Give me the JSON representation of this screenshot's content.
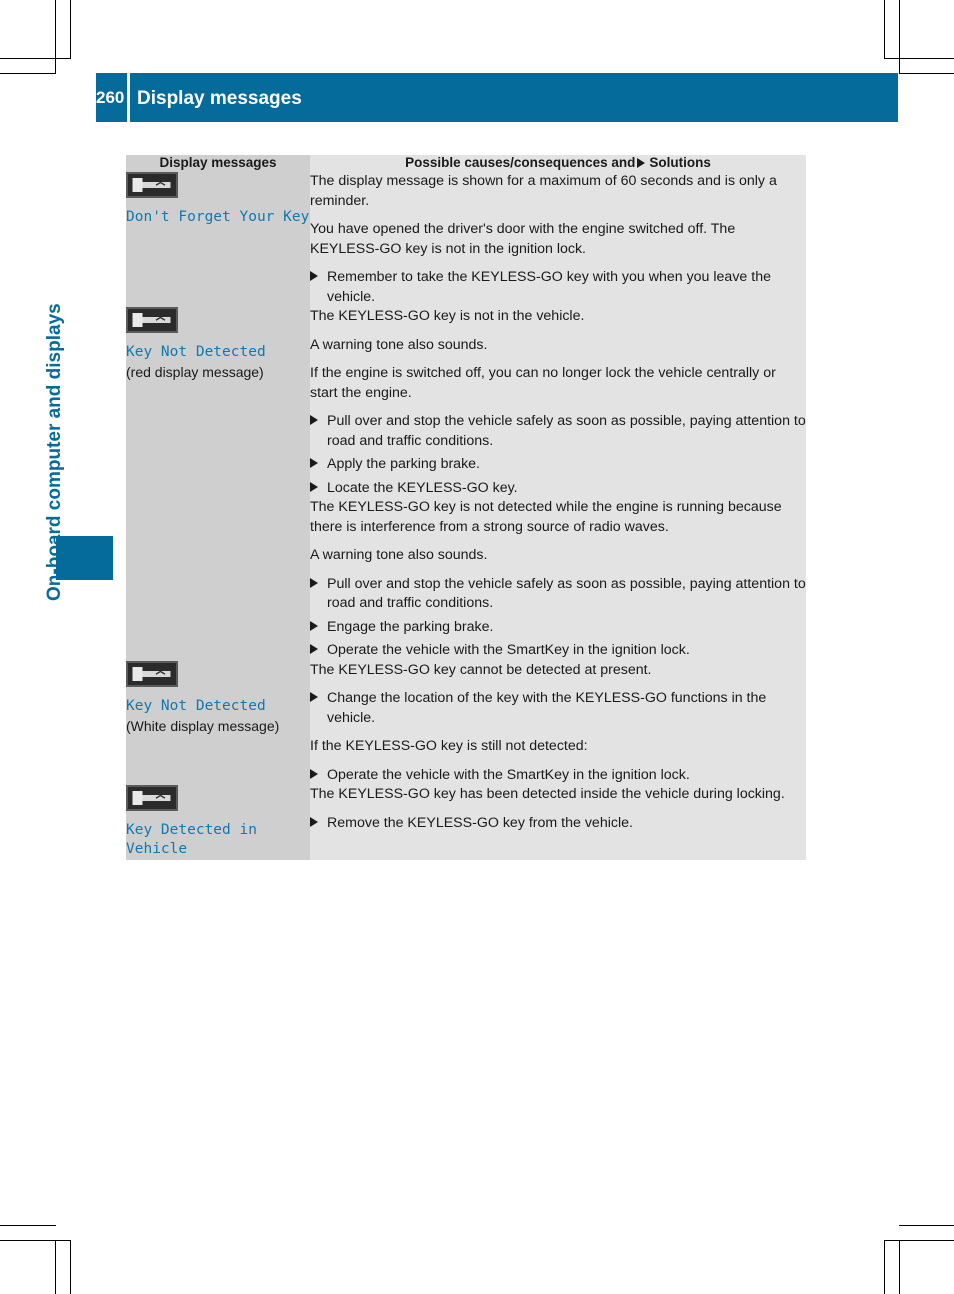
{
  "page": {
    "number": "260",
    "header_title": "Display messages",
    "chapter_label": "On-board computer and displays",
    "accent_color": "#046b9b",
    "message_text_color": "#1178b0"
  },
  "table": {
    "headers": {
      "col1": "Display messages",
      "col2_before_icon": "Possible causes/consequences and",
      "col2_after_icon": "Solutions",
      "solutions_arrow_icon": "solid-right-triangle-icon"
    },
    "rows": [
      {
        "icon": "keyless-go-key-icon",
        "message": "Don't Forget Your Key",
        "note": "",
        "blocks": [
          {
            "paragraphs": [
              "The display message is shown for a maximum of 60 seconds and is only a reminder.",
              "You have opened the driver's door with the engine switched off. The KEYLESS-GO key is not in the ignition lock."
            ],
            "steps": [
              "Remember to take the KEYLESS-GO key with you when you leave the vehicle."
            ]
          }
        ]
      },
      {
        "icon": "keyless-go-key-icon",
        "message": "Key Not Detected",
        "note": "(red display message)",
        "blocks": [
          {
            "paragraphs": [
              "The KEYLESS-GO key is not in the vehicle.",
              "A warning tone also sounds.",
              "If the engine is switched off, you can no longer lock the vehicle centrally or start the engine."
            ],
            "steps": [
              "Pull over and stop the vehicle safely as soon as possible, paying attention to road and traffic conditions.",
              "Apply the parking brake.",
              "Locate the KEYLESS-GO key."
            ]
          },
          {
            "paragraphs": [
              "The KEYLESS-GO key is not detected while the engine is running because there is interference from a strong source of radio waves.",
              "A warning tone also sounds."
            ],
            "steps": [
              "Pull over and stop the vehicle safely as soon as possible, paying attention to road and traffic conditions.",
              "Engage the parking brake.",
              "Operate the vehicle with the SmartKey in the ignition lock."
            ]
          }
        ]
      },
      {
        "icon": "keyless-go-key-icon",
        "message": "Key Not Detected",
        "note": "(White display message)",
        "blocks": [
          {
            "paragraphs": [
              "The KEYLESS-GO key cannot be detected at present."
            ],
            "steps": [
              "Change the location of the key with the KEYLESS-GO functions in the vehicle."
            ],
            "paragraphs2": [
              "If the KEYLESS-GO key is still not detected:"
            ],
            "steps2": [
              "Operate the vehicle with the SmartKey in the ignition lock."
            ]
          }
        ]
      },
      {
        "icon": "keyless-go-key-icon",
        "message": "Key Detected in Vehicle",
        "note": "",
        "blocks": [
          {
            "paragraphs": [
              "The KEYLESS-GO key has been detected inside the vehicle during locking."
            ],
            "steps": [
              "Remove the KEYLESS-GO key from the vehicle."
            ]
          }
        ]
      }
    ]
  }
}
